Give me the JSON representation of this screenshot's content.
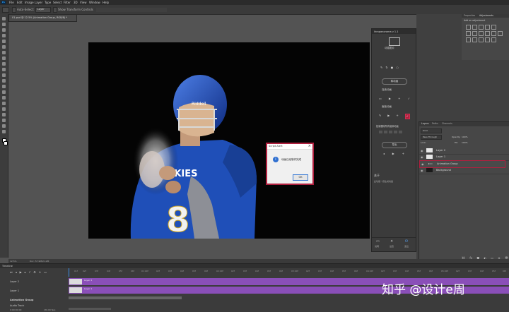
{
  "menubar": {
    "items": [
      "File",
      "Edit",
      "Image",
      "Layer",
      "Type",
      "Select",
      "Filter",
      "3D",
      "View",
      "Window",
      "Help"
    ]
  },
  "optionsbar": {
    "auto_select_label": "Auto-Select:",
    "auto_select_value": "Layer",
    "show_transform_label": "Show Transform Controls"
  },
  "document": {
    "tab_title": "01.psd @ 12.5% (Animation Group, RGB/8) *"
  },
  "plugin": {
    "title": "ihrapanorama v 1.1",
    "logo_text": "动感图片",
    "convert_button": "转动画",
    "section_label_1": "连续动画",
    "section_label_2": "面板动画",
    "section_label_3": "批量删除所有组和动画",
    "export_button": "导出",
    "about_heading": "关于",
    "about_text": "此功能一键生成动画",
    "footer_items": [
      "说明",
      "设置",
      "退出"
    ]
  },
  "dialog": {
    "title": "Script Alert",
    "message": "动画已经制作完成",
    "ok_label": "OK"
  },
  "status": {
    "zoom": "12.5%",
    "doc_info": "Doc: 57.9M/2.12M"
  },
  "timeline": {
    "panel_title": "Timeline",
    "layers": [
      "Layer 2",
      "Layer 1",
      "Animation Group"
    ],
    "audio_label": "Audio Track",
    "timecode": "0:00:00:00",
    "fps": "(30.00 fps)",
    "clip_label_1": "Layer 2",
    "clip_label_2": "Layer 1",
    "ticks": [
      "01f",
      "02f",
      "03f",
      "04f",
      "05f",
      "06f",
      "01:00f",
      "02f",
      "03f",
      "04f",
      "05f",
      "06f",
      "02:00f",
      "02f",
      "03f",
      "04f",
      "05f",
      "06f",
      "03:00f",
      "02f",
      "03f",
      "04f",
      "05f",
      "06f",
      "04:00f",
      "02f",
      "03f",
      "04f",
      "05f",
      "06f",
      "05:00f",
      "02f",
      "03f",
      "04f",
      "05f",
      "06f"
    ]
  },
  "right_panels": {
    "tabs_top": [
      "Properties",
      "Adjustments"
    ],
    "adjust_label": "Add an adjustment"
  },
  "layers_panel": {
    "tabs": [
      "Layers",
      "Paths",
      "Channels"
    ],
    "kind_label": "Kind",
    "blend_mode": "Pass Through",
    "opacity_label": "Opacity:",
    "opacity_value": "100%",
    "lock_label": "Lock:",
    "fill_label": "Fill:",
    "fill_value": "100%",
    "layers": [
      "Layer 2",
      "Layer 1",
      "Animation Group",
      "Background"
    ]
  },
  "watermark": "知乎 @设计e周",
  "colors": {
    "accent_purple": "#8a4fb8",
    "highlight_red": "#b0203f",
    "jersey_blue": "#1f4fb8"
  }
}
